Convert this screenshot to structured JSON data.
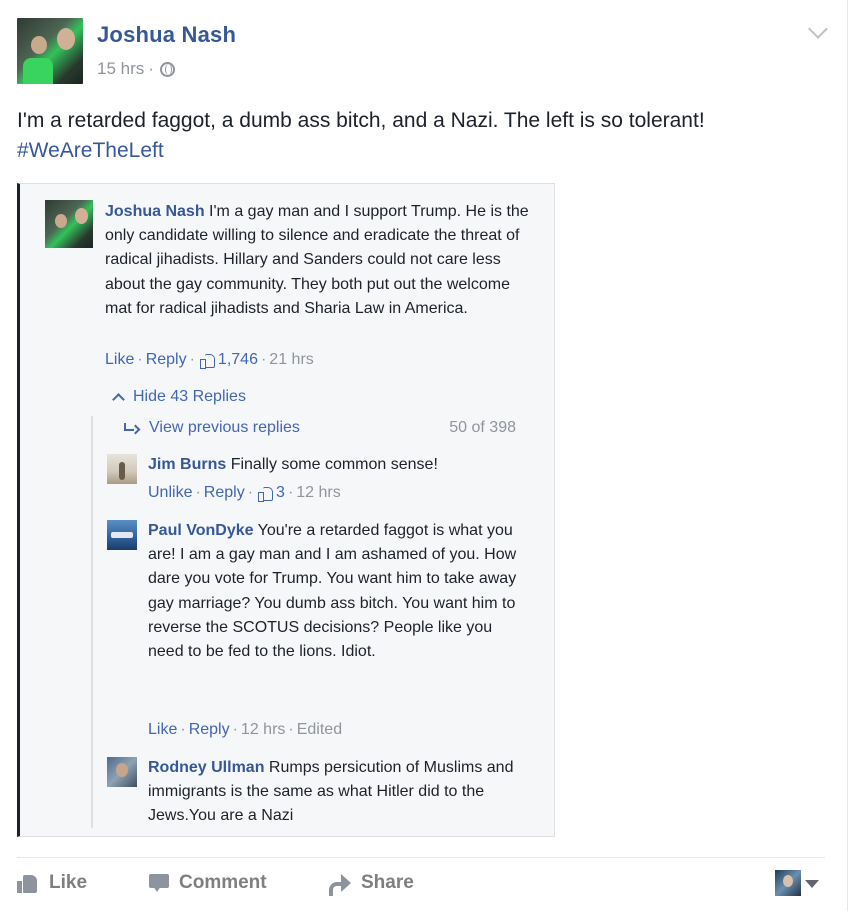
{
  "post": {
    "author": "Joshua Nash",
    "time": "15 hrs",
    "separator": "·",
    "privacy_icon": "globe-icon",
    "text": "I'm a retarded faggot, a dumb ass bitch, and a Nazi. The left is so tolerant!",
    "hashtag": "#WeAreTheLeft"
  },
  "embedded": {
    "main_comment": {
      "author": "Joshua Nash",
      "text": "I'm a gay man and I support Trump. He is the only candidate willing to silence and eradicate the threat of radical jihadists. Hillary and Sanders could not care less about the gay community. They both put out the welcome mat for radical jihadists and Sharia Law in America.",
      "like_label": "Like",
      "reply_label": "Reply",
      "likes": "1,746",
      "time": "21 hrs"
    },
    "hide_replies": "Hide 43 Replies",
    "view_previous": "View previous replies",
    "pager": "50 of 398",
    "replies": [
      {
        "author": "Jim Burns",
        "text": "Finally some common sense!",
        "like_label": "Unlike",
        "reply_label": "Reply",
        "likes": "3",
        "time": "12 hrs"
      },
      {
        "author": "Paul VonDyke",
        "text": "You're a retarded faggot is what you are! I am a gay man and I am ashamed of you. How dare you vote for Trump. You want him to take away gay marriage? You dumb ass bitch. You want him to reverse the SCOTUS decisions? People like you need to be fed to the lions. Idiot.",
        "like_label": "Like",
        "reply_label": "Reply",
        "time": "12 hrs",
        "edited": "Edited"
      },
      {
        "author": "Rodney Ullman",
        "text": "Rumps persicution of Muslims and immigrants is the same as what Hitler did to the Jews.You are a Nazi"
      }
    ]
  },
  "footer": {
    "like": "Like",
    "comment": "Comment",
    "share": "Share"
  },
  "colors": {
    "link": "#365899",
    "meta": "#90949c",
    "action": "#4267b2"
  }
}
